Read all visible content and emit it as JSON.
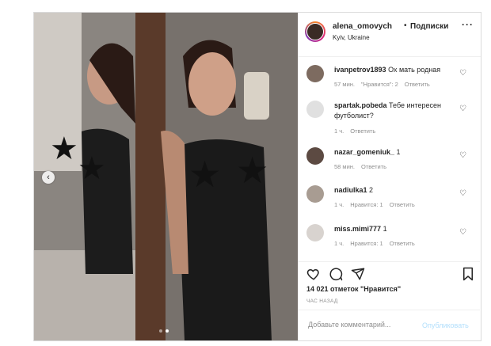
{
  "post": {
    "header": {
      "username": "alena_omovych",
      "dot": "•",
      "follow_label": "Подписки",
      "location": "Kyiv, Ukraine",
      "more_icon": "more-horizontal-icon"
    },
    "carousel": {
      "prev_icon": "chevron-left-icon",
      "total": 2,
      "active": 2
    },
    "comments": [
      {
        "username": "ivanpetrov1893",
        "text": "Ох мать родная",
        "time": "57 мин.",
        "likes": "\"Нравится\": 2",
        "reply": "Ответить"
      },
      {
        "username": "spartak.pobeda",
        "text": "Тебе интересен футболист?",
        "time": "1 ч.",
        "likes": "",
        "reply": "Ответить"
      },
      {
        "username": "nazar_gomeniuk_",
        "text": "1",
        "time": "58 мин.",
        "likes": "",
        "reply": "Ответить"
      },
      {
        "username": "nadiulka1",
        "text": "2",
        "time": "1 ч.",
        "likes": "Нравится: 1",
        "reply": "Ответить"
      },
      {
        "username": "miss.mimi777",
        "text": "1",
        "time": "1 ч.",
        "likes": "Нравится: 1",
        "reply": "Ответить"
      }
    ],
    "likes_text": "14 021 отметок \"Нравится\"",
    "time_ago": "ЧАС НАЗАД",
    "add_comment_placeholder": "Добавьте комментарий...",
    "publish_label": "Опубликовать",
    "colors": {
      "border": "#dbdbdb",
      "muted": "#8e8e8e",
      "publish": "#b2dffc"
    }
  }
}
